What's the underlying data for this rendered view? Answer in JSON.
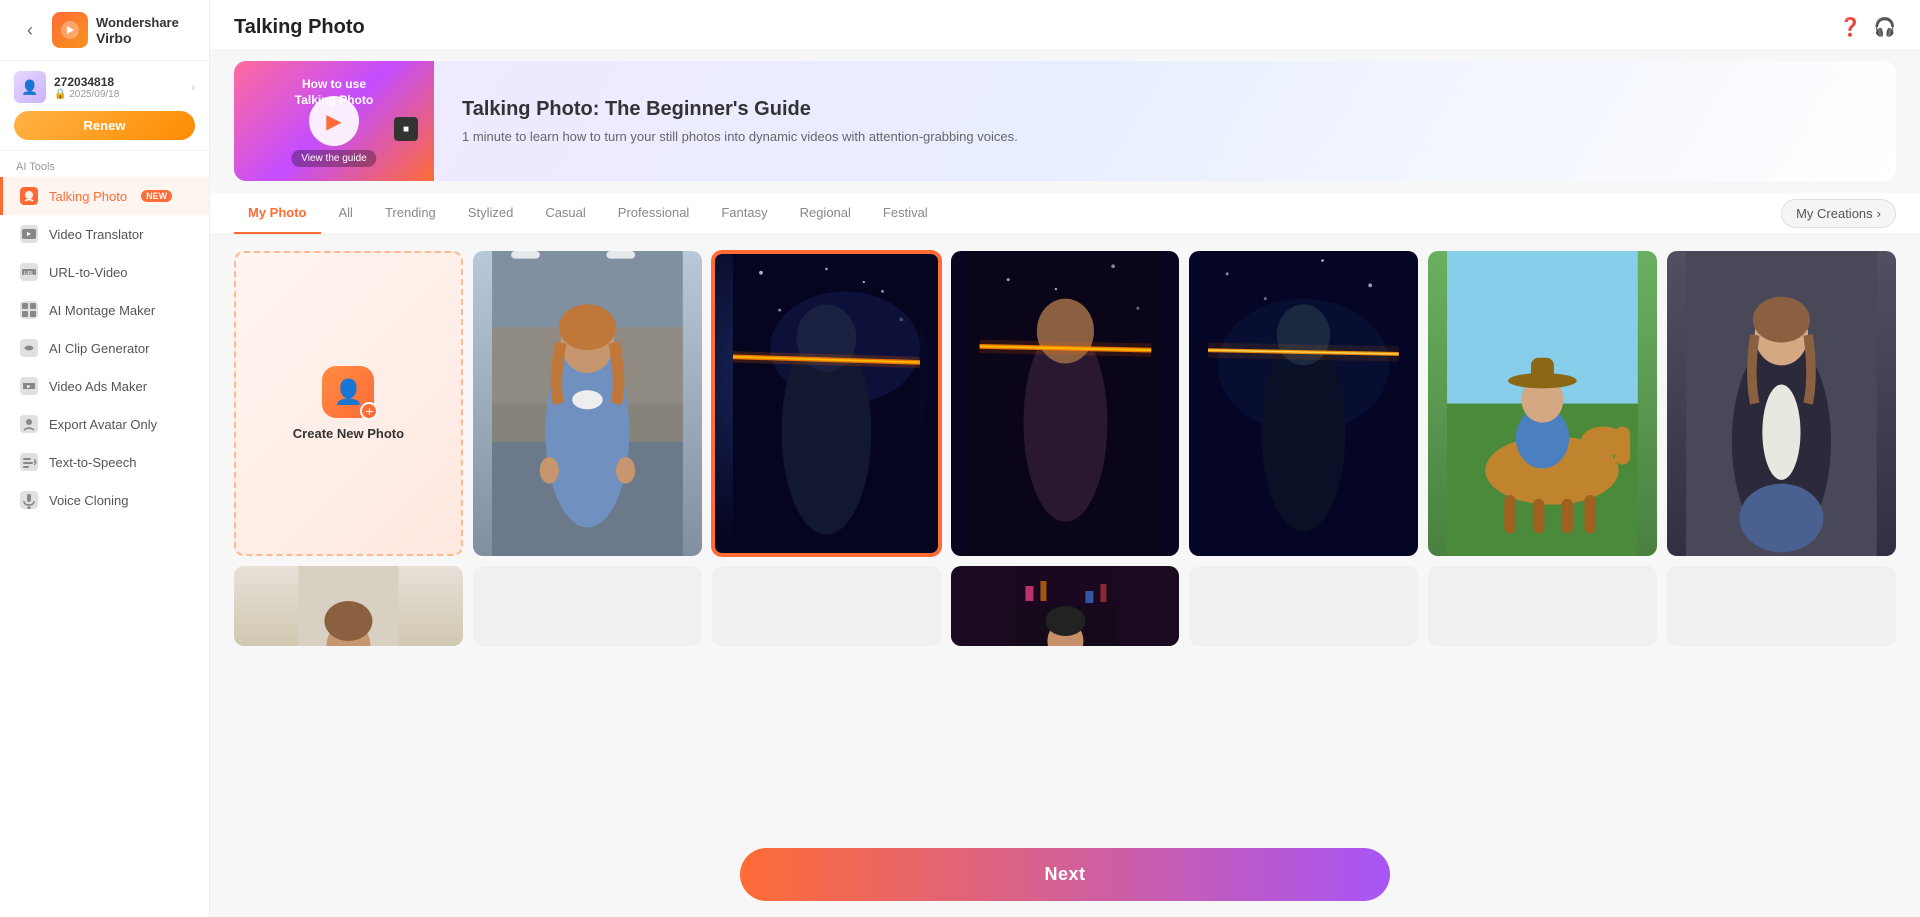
{
  "app": {
    "name": "Virbo",
    "company": "Wondershare"
  },
  "user": {
    "id": "272034818",
    "date": "2025/09/18",
    "renew_label": "Renew"
  },
  "sidebar": {
    "ai_tools_label": "AI Tools",
    "nav_items": [
      {
        "id": "talking-photo",
        "label": "Talking Photo",
        "badge": "NEW",
        "active": true
      },
      {
        "id": "video-translator",
        "label": "Video Translator",
        "active": false
      },
      {
        "id": "url-to-video",
        "label": "URL-to-Video",
        "active": false
      },
      {
        "id": "ai-montage-maker",
        "label": "AI Montage Maker",
        "active": false
      },
      {
        "id": "ai-clip-generator",
        "label": "AI Clip Generator",
        "active": false
      },
      {
        "id": "video-ads-maker",
        "label": "Video Ads Maker",
        "active": false
      },
      {
        "id": "export-avatar-only",
        "label": "Export Avatar Only",
        "active": false
      },
      {
        "id": "text-to-speech",
        "label": "Text-to-Speech",
        "active": false
      },
      {
        "id": "voice-cloning",
        "label": "Voice Cloning",
        "active": false
      }
    ]
  },
  "header": {
    "title": "Talking Photo",
    "help_icon": "?",
    "headphone_icon": "🎧"
  },
  "banner": {
    "label_line1": "How to use",
    "label_line2": "Talking Photo",
    "view_guide": "View the guide",
    "title": "Talking Photo: The Beginner's Guide",
    "description": "1 minute to learn how to turn your still photos into dynamic videos with attention-grabbing voices."
  },
  "tabs": {
    "items": [
      {
        "id": "my-photo",
        "label": "My Photo",
        "active": true
      },
      {
        "id": "all",
        "label": "All",
        "active": false
      },
      {
        "id": "trending",
        "label": "Trending",
        "active": false
      },
      {
        "id": "stylized",
        "label": "Stylized",
        "active": false
      },
      {
        "id": "casual",
        "label": "Casual",
        "active": false
      },
      {
        "id": "professional",
        "label": "Professional",
        "active": false
      },
      {
        "id": "fantasy",
        "label": "Fantasy",
        "active": false
      },
      {
        "id": "regional",
        "label": "Regional",
        "active": false
      },
      {
        "id": "festival",
        "label": "Festival",
        "active": false
      }
    ],
    "my_creations_label": "My Creations",
    "my_creations_arrow": "›"
  },
  "grid": {
    "create_card_label": "Create New Photo",
    "selected_card_index": 2
  },
  "next_button": {
    "label": "Next"
  }
}
